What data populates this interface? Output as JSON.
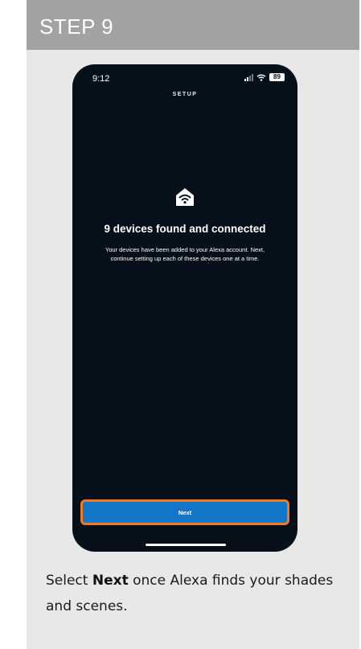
{
  "step": {
    "title": "STEP 9"
  },
  "phone": {
    "status": {
      "time": "9:12",
      "battery": "89"
    },
    "header_label": "SETUP",
    "icon": "hub-wifi-icon",
    "title": "9 devices found and connected",
    "description": "Your devices have been added to your Alexa account. Next, continue setting up each of these devices one at a time.",
    "next_button": "Next"
  },
  "instructions": {
    "prefix": "Select ",
    "emphasis": "Next",
    "suffix": " once Alexa finds your shades and scenes."
  },
  "colors": {
    "header_bg": "#a2a2a2",
    "card_bg": "#e8e8e8",
    "phone_bg": "#05101a",
    "button_blue": "#1377c9",
    "highlight_orange": "#f07a22"
  }
}
